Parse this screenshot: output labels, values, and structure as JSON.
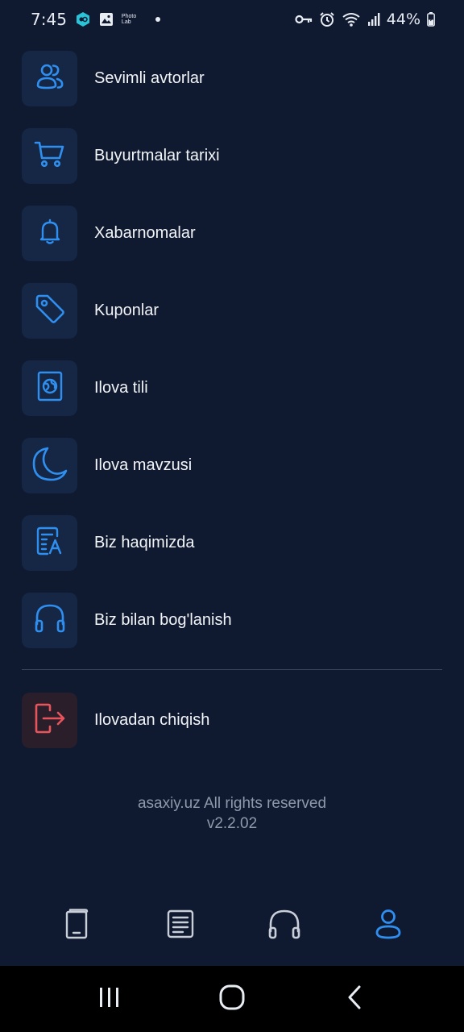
{
  "status_bar": {
    "time": "7:45",
    "photolab_label": "Photo Lab",
    "battery": "44%"
  },
  "menu": {
    "items": [
      {
        "label": "Sevimli avtorlar",
        "icon": "users-icon"
      },
      {
        "label": "Buyurtmalar tarixi",
        "icon": "cart-icon"
      },
      {
        "label": "Xabarnomalar",
        "icon": "bell-icon"
      },
      {
        "label": "Kuponlar",
        "icon": "tag-icon"
      },
      {
        "label": "Ilova tili",
        "icon": "globe-icon"
      },
      {
        "label": "Ilova mavzusi",
        "icon": "moon-icon"
      },
      {
        "label": "Biz haqimizda",
        "icon": "document-icon"
      },
      {
        "label": "Biz bilan bog'lanish",
        "icon": "headphones-icon"
      }
    ],
    "logout": {
      "label": "Ilovadan chiqish",
      "icon": "logout-icon"
    }
  },
  "footer": {
    "copyright": "asaxiy.uz All rights reserved",
    "version": "v2.2.02"
  },
  "bottom_nav": {
    "items": [
      {
        "icon": "ebook-icon",
        "active": false
      },
      {
        "icon": "book-icon",
        "active": false
      },
      {
        "icon": "audiobook-icon",
        "active": false
      },
      {
        "icon": "profile-icon",
        "active": true
      }
    ]
  },
  "colors": {
    "background": "#0f1a30",
    "icon_box": "#152744",
    "accent": "#2f8ff0",
    "danger": "#e8545c",
    "muted_text": "#8e99ab",
    "inactive_icon": "#c9cfd8"
  }
}
